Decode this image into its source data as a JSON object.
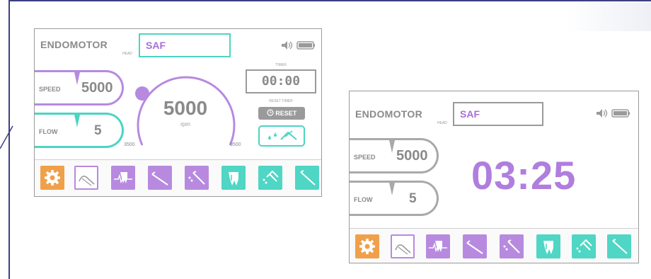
{
  "colors": {
    "purple": "#b78ae0",
    "teal": "#4dd4c3",
    "orange": "#f0a04a",
    "gray": "#8a8a8a"
  },
  "screen1": {
    "brand": "ENDOMOTOR",
    "head_label": "HEAD",
    "head_value": "SAF",
    "speed_label": "SPEED",
    "speed_value": "5000",
    "flow_label": "FLOW",
    "flow_value": "5",
    "dial_value": "5000",
    "dial_unit": "rpm",
    "dial_min": "3500",
    "dial_max": "9500",
    "timer_label": "TIMER",
    "timer_value": "00:00",
    "reset_timer_label": "RESET TIMER",
    "reset_button": "RESET",
    "tools": [
      {
        "icon": "gear-icon",
        "style": "orange"
      },
      {
        "icon": "handpiece-icon",
        "style": "outline"
      },
      {
        "icon": "tooth-pulse-icon",
        "style": "purple"
      },
      {
        "icon": "file-icon",
        "style": "purple"
      },
      {
        "icon": "spray-handpiece-icon",
        "style": "purple"
      },
      {
        "icon": "tooth-icon",
        "style": "teal"
      },
      {
        "icon": "spray-handpiece-icon",
        "style": "teal"
      },
      {
        "icon": "file-icon",
        "style": "teal"
      }
    ]
  },
  "screen2": {
    "brand": "ENDOMOTOR",
    "head_label": "HEAD",
    "head_value": "SAF",
    "speed_label": "SPEED",
    "speed_value": "5000",
    "flow_label": "FLOW",
    "flow_value": "5",
    "big_time": "03:25"
  }
}
